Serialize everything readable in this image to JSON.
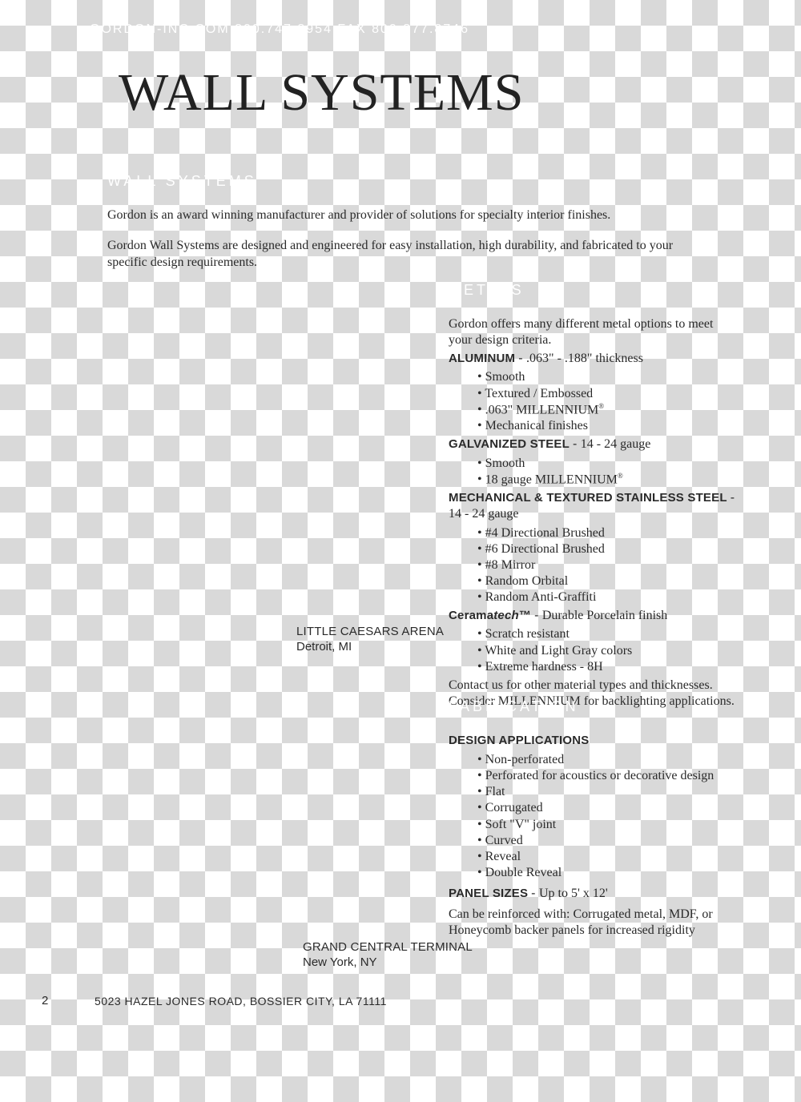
{
  "header": {
    "top_bar": "GORDON-INC.COM   800.747.8954   FAX 800.877.8746",
    "title": "WALL SYSTEMS"
  },
  "section_labels": {
    "wall": "WALL SYSTEMS",
    "metals": "METALS",
    "fabrication": "FABRICATION"
  },
  "intro": {
    "p1": "Gordon is an award winning manufacturer and provider of solutions for specialty interior finishes.",
    "p2": "Gordon Wall Systems are designed and engineered for easy installation, high durability, and fabricated to your specific design requirements."
  },
  "metals": {
    "lead": "Gordon offers many different metal options to meet your design criteria.",
    "aluminum": {
      "label": "ALUMINUM",
      "spec": ".063\" - .188\" thickness",
      "items": [
        "Smooth",
        "Textured / Embossed",
        ".063\" MILLENNIUM",
        "Mechanical finishes"
      ]
    },
    "galv": {
      "label": "GALVANIZED STEEL",
      "spec": "14 - 24 gauge",
      "items": [
        "Smooth",
        "18 gauge MILLENNIUM"
      ]
    },
    "stainless": {
      "label": "MECHANICAL & TEXTURED STAINLESS STEEL",
      "spec": "14 - 24 gauge",
      "items": [
        "#4 Directional Brushed",
        "#6 Directional Brushed",
        "#8 Mirror",
        "Random Orbital",
        "Random Anti-Graffiti"
      ]
    },
    "ceramatech": {
      "label_a": "Cerama",
      "label_b": "tech",
      "tm": "™",
      "spec": "Durable Porcelain finish",
      "items": [
        "Scratch resistant",
        "White and Light Gray colors",
        "Extreme hardness - 8H"
      ]
    },
    "closing": "Contact us for other material types and thicknesses. Consider MILLENNIUM for backlighting applica­tions."
  },
  "fabrication": {
    "design_heading": "DESIGN APPLICATIONS",
    "design_items": [
      "Non-perforated",
      "Perforated for acoustics or decorative design",
      "Flat",
      "Corrugated",
      "Soft \"V\" joint",
      "Curved",
      "Reveal",
      "Double Reveal"
    ],
    "panel_label": "PANEL SIZES",
    "panel_spec": "Up to 5' x 12'",
    "reinforce": "Can be reinforced with: Corrugated metal, MDF, or Honeycomb backer panels for increased rigidity"
  },
  "captions": {
    "c1_title": "LITTLE CAESARS ARENA",
    "c1_loc": "Detroit, MI",
    "c2_title": "GRAND CENTRAL TERMINAL",
    "c2_loc": "New York, NY"
  },
  "footer": {
    "page": "2",
    "address": "5023 HAZEL JONES ROAD, BOSSIER CITY, LA 71111"
  }
}
